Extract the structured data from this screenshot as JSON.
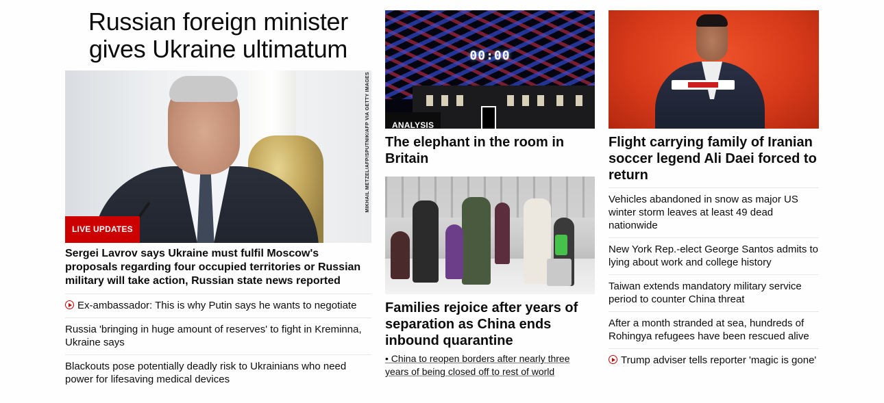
{
  "col1": {
    "headline": "Russian foreign minister gives Ukraine ultimatum",
    "photo_credit": "MIKHAIL METZEL/AFP/SPUTNIK/AFP VIA GETTY IMAGES",
    "badge": "LIVE UPDATES",
    "lead": "Sergei Lavrov says Ukraine must fulfil Moscow's proposals regarding four occupied territories or Russian military will take action, Russian state news reported",
    "items": [
      {
        "text": "Ex-ambassador: This is why Putin says he wants to negotiate",
        "icon": "play-icon"
      },
      {
        "text": "Russia 'bringing in huge amount of reserves' to fight in Kreminna, Ukraine says"
      },
      {
        "text": "Blackouts pose potentially deadly risk to Ukrainians who need power for lifesaving medical devices"
      }
    ]
  },
  "col2": {
    "story1": {
      "badge": "ANALYSIS",
      "clock": "00:00",
      "headline": "The elephant in the room in Britain"
    },
    "story2": {
      "headline": "Families rejoice after years of separation as China ends inbound quarantine",
      "sublink": "• China to reopen borders after nearly three years of being closed off to rest of world"
    }
  },
  "col3": {
    "headline": "Flight carrying family of Iranian soccer legend Ali Daei forced to return",
    "items": [
      {
        "text": "Vehicles abandoned in snow as major US winter storm leaves at least 49 dead nationwide"
      },
      {
        "text": "New York Rep.-elect George Santos admits to lying about work and college history"
      },
      {
        "text": "Taiwan extends mandatory military service period to counter China threat"
      },
      {
        "text": "After a month stranded at sea, hundreds of Rohingya refugees have been rescued alive"
      },
      {
        "text": "Trump adviser tells reporter 'magic is gone'",
        "icon": "play-icon"
      }
    ]
  },
  "colors": {
    "accent_red": "#cc0000",
    "analysis_badge": "#0c0c0c",
    "text": "#0c0c0c",
    "divider": "#e6e6e6"
  }
}
